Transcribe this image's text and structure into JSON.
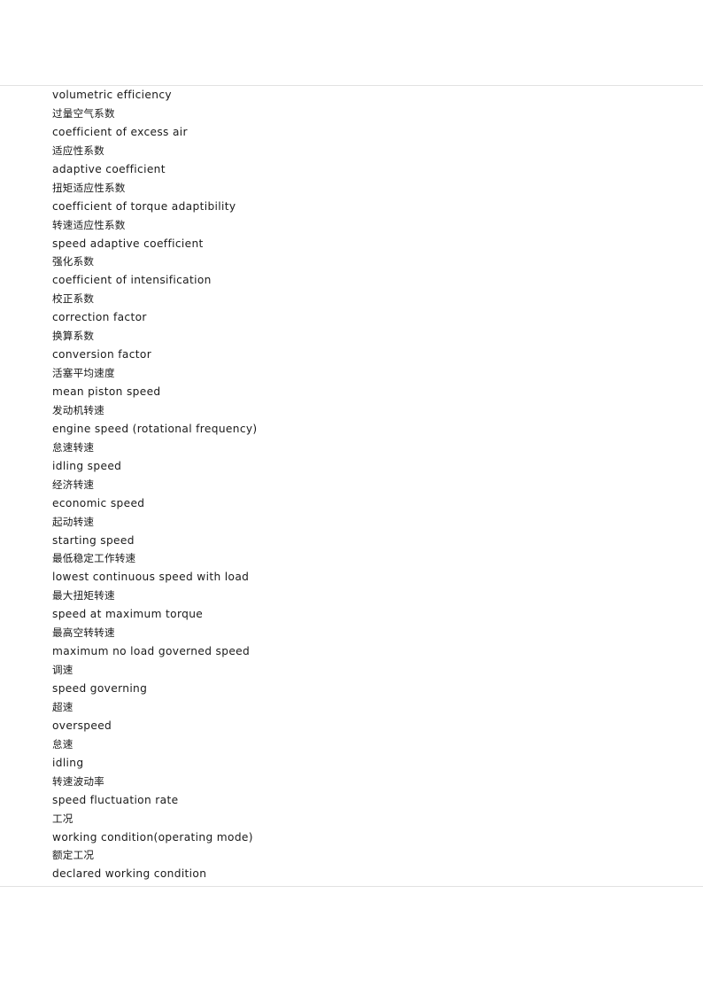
{
  "page": {
    "background_color": "#ffffff",
    "text_color": "#1a1a1a",
    "rule_color": "#e2e2e2"
  },
  "glossary": {
    "entries": [
      {
        "lang": "en",
        "text": "volumetric efficiency"
      },
      {
        "lang": "zh",
        "text": "过量空气系数"
      },
      {
        "lang": "en",
        "text": "coefficient of excess air"
      },
      {
        "lang": "zh",
        "text": "适应性系数"
      },
      {
        "lang": "en",
        "text": "adaptive coefficient"
      },
      {
        "lang": "zh",
        "text": "扭矩适应性系数"
      },
      {
        "lang": "en",
        "text": "coefficient of torque adaptibility"
      },
      {
        "lang": "zh",
        "text": "转速适应性系数"
      },
      {
        "lang": "en",
        "text": "speed adaptive coefficient"
      },
      {
        "lang": "zh",
        "text": "强化系数"
      },
      {
        "lang": "en",
        "text": "coefficient of intensification"
      },
      {
        "lang": "zh",
        "text": "校正系数"
      },
      {
        "lang": "en",
        "text": "correction factor"
      },
      {
        "lang": "zh",
        "text": "换算系数"
      },
      {
        "lang": "en",
        "text": "conversion factor"
      },
      {
        "lang": "zh",
        "text": "活塞平均速度"
      },
      {
        "lang": "en",
        "text": "mean piston speed"
      },
      {
        "lang": "zh",
        "text": "发动机转速"
      },
      {
        "lang": "en",
        "text": "engine speed (rotational frequency)"
      },
      {
        "lang": "zh",
        "text": "怠速转速"
      },
      {
        "lang": "en",
        "text": "idling speed"
      },
      {
        "lang": "zh",
        "text": "经济转速"
      },
      {
        "lang": "en",
        "text": "economic speed"
      },
      {
        "lang": "zh",
        "text": "起动转速"
      },
      {
        "lang": "en",
        "text": "starting speed"
      },
      {
        "lang": "zh",
        "text": "最低稳定工作转速"
      },
      {
        "lang": "en",
        "text": "lowest continuous speed with load"
      },
      {
        "lang": "zh",
        "text": "最大扭矩转速"
      },
      {
        "lang": "en",
        "text": "speed at maximum torque"
      },
      {
        "lang": "zh",
        "text": "最高空转转速"
      },
      {
        "lang": "en",
        "text": "maximum no load governed speed"
      },
      {
        "lang": "zh",
        "text": "调速"
      },
      {
        "lang": "en",
        "text": "speed governing"
      },
      {
        "lang": "zh",
        "text": "超速"
      },
      {
        "lang": "en",
        "text": "overspeed"
      },
      {
        "lang": "zh",
        "text": "怠速"
      },
      {
        "lang": "en",
        "text": "idling"
      },
      {
        "lang": "zh",
        "text": "转速波动率"
      },
      {
        "lang": "en",
        "text": "speed fluctuation rate"
      },
      {
        "lang": "zh",
        "text": "工况"
      },
      {
        "lang": "en",
        "text": "working condition(operating mode)"
      },
      {
        "lang": "zh",
        "text": "额定工况"
      },
      {
        "lang": "en",
        "text": "declared working condition"
      }
    ]
  }
}
